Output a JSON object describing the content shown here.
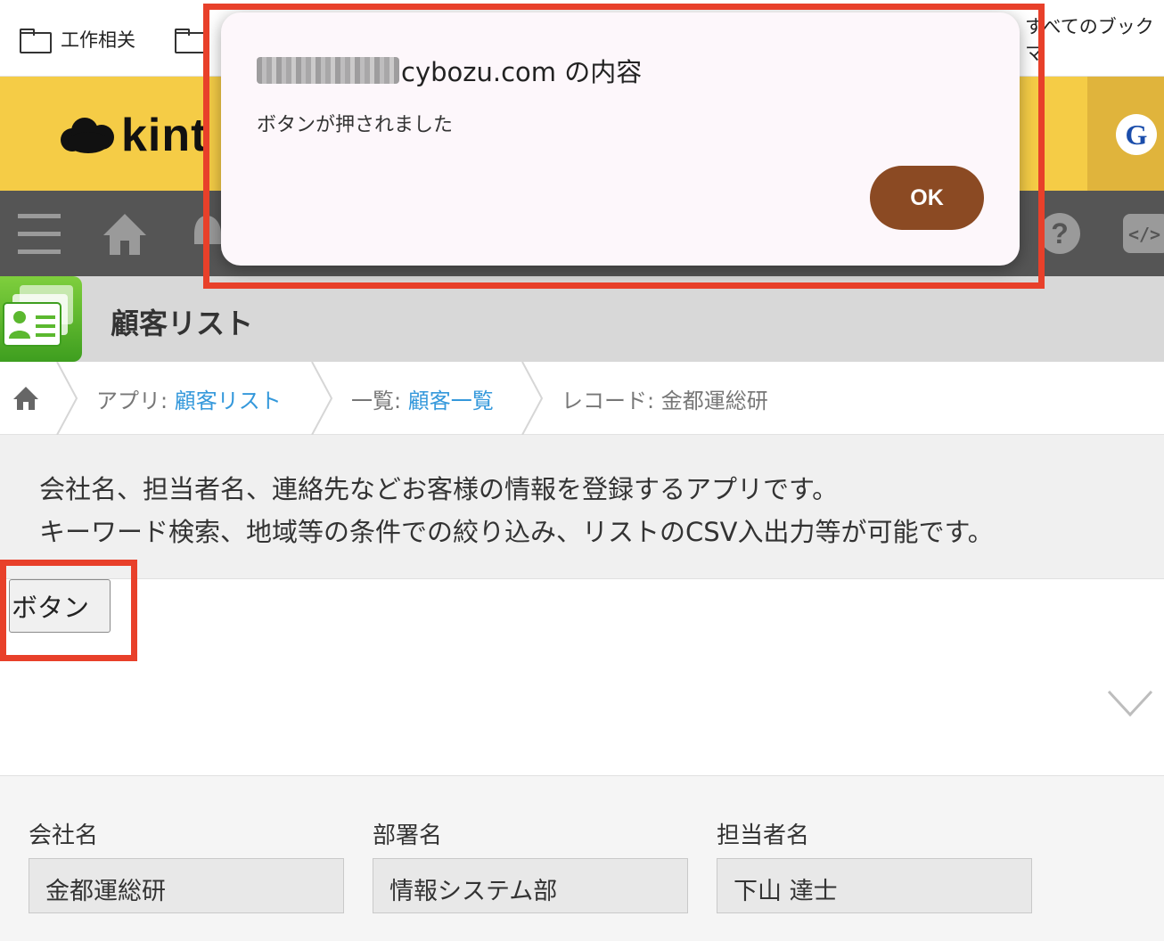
{
  "bookmarks": {
    "folder1": "工作相关",
    "all_bookmarks": "すべてのブックマ"
  },
  "header": {
    "logo_text": "kint",
    "profile_initial": "G"
  },
  "app": {
    "title": "顧客リスト"
  },
  "breadcrumb": {
    "app_label": "アプリ: ",
    "app_link": "顧客リスト",
    "view_label": "一覧: ",
    "view_link": "顧客一覧",
    "record_label": "レコード: 金都運総研"
  },
  "description": {
    "line1": "会社名、担当者名、連絡先などお客様の情報を登録するアプリです。",
    "line2": "キーワード検索、地域等の条件での絞り込み、リストのCSV入出力等が可能です。"
  },
  "custom_button": {
    "label": "ボタン"
  },
  "record": {
    "fields": [
      {
        "label": "会社名",
        "value": "金都運総研"
      },
      {
        "label": "部署名",
        "value": "情報システム部"
      },
      {
        "label": "担当者名",
        "value": "下山 達士"
      }
    ]
  },
  "dialog": {
    "title_suffix": "cybozu.com の内容",
    "message": "ボタンが押されました",
    "ok_label": "OK"
  },
  "colors": {
    "header_yellow": "#f5cc46",
    "nav_gray": "#555555",
    "highlight_red": "#e8402a",
    "ok_brown": "#8b4a23",
    "link_blue": "#3498db"
  }
}
